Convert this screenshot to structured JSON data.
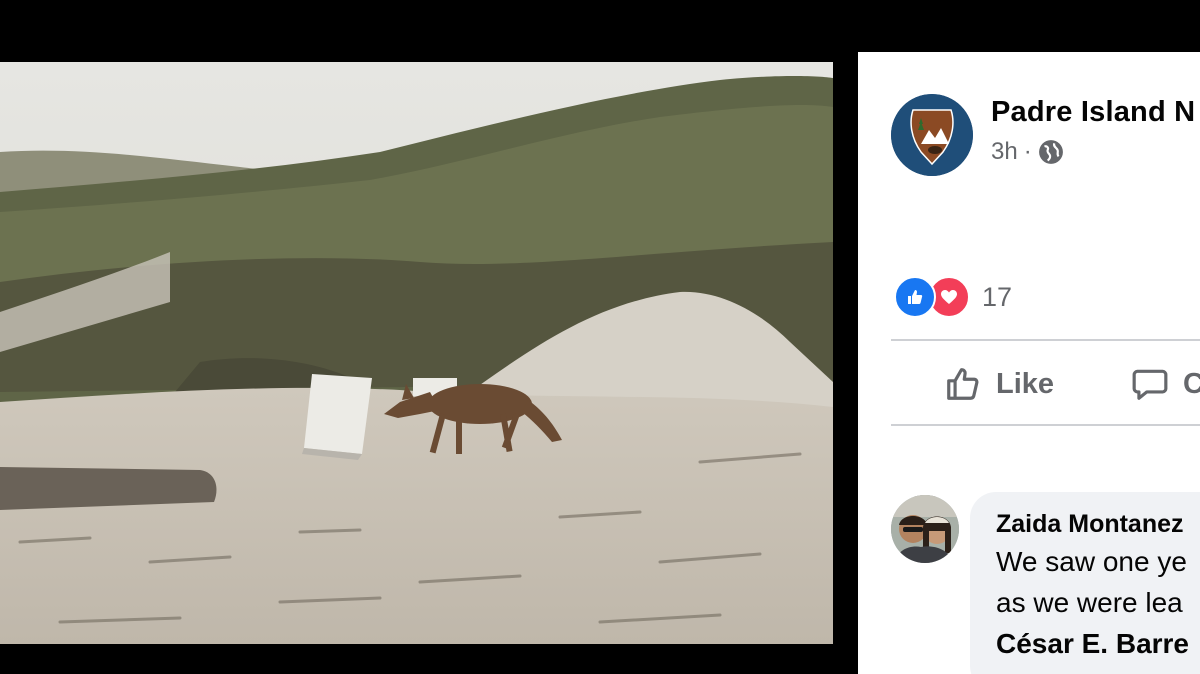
{
  "photo": {
    "subject_icon": "coyote-photo"
  },
  "post": {
    "page_name": "Padre Island N",
    "time": "3h",
    "separator": "·",
    "privacy_icon": "globe-icon",
    "avatar_icon": "nps-arrowhead-icon"
  },
  "reactions": {
    "icons": [
      "like-reaction-icon",
      "love-reaction-icon"
    ],
    "count": "17"
  },
  "actions": {
    "like_label": "Like",
    "comment_label": "C"
  },
  "comment": {
    "author": "Zaida Montanez",
    "line1": "We saw one ye",
    "line2": "as we were lea",
    "tag": "César E. Barre"
  },
  "colors": {
    "like_blue": "#1877f2",
    "love_red": "#f33e58",
    "nps_brown": "#8b4a24",
    "secondary_text": "#65676b"
  }
}
